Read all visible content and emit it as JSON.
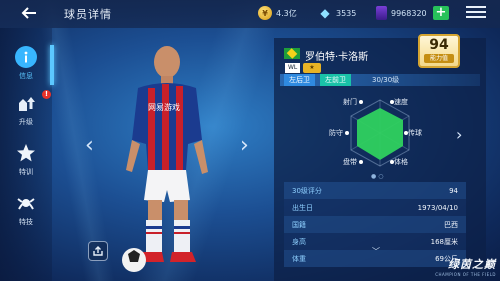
{
  "header": {
    "title": "球员详情",
    "coins": "4.3亿",
    "gems": "3535",
    "cards": "9968320",
    "plus": "+"
  },
  "nav": [
    {
      "label": "信息",
      "icon": "info-icon",
      "active": true
    },
    {
      "label": "升级",
      "icon": "upgrade-icon",
      "badge": "!"
    },
    {
      "label": "特训",
      "icon": "star-icon"
    },
    {
      "label": "特技",
      "icon": "skill-icon"
    }
  ],
  "player": {
    "name": "罗伯特·卡洛斯",
    "tag": "WL",
    "rating": "94",
    "rating_label": "能力值",
    "positions": [
      "左后卫",
      "左前卫"
    ],
    "level": "30/30级"
  },
  "radar": {
    "stats": [
      "射门",
      "速度",
      "传球",
      "体格",
      "盘带",
      "防守"
    ]
  },
  "info": [
    {
      "k": "30级评分",
      "v": "94"
    },
    {
      "k": "出生日",
      "v": "1973/04/10"
    },
    {
      "k": "国籍",
      "v": "巴西"
    },
    {
      "k": "身高",
      "v": "168厘米"
    },
    {
      "k": "体重",
      "v": "69公斤"
    }
  ],
  "logo": {
    "main": "绿茵之巅",
    "sub": "CHAMPION OF THE FIELD"
  },
  "colors": {
    "accent": "#38b6ff",
    "radar_fill": "#2fd15f",
    "gold": "#d5a532"
  }
}
